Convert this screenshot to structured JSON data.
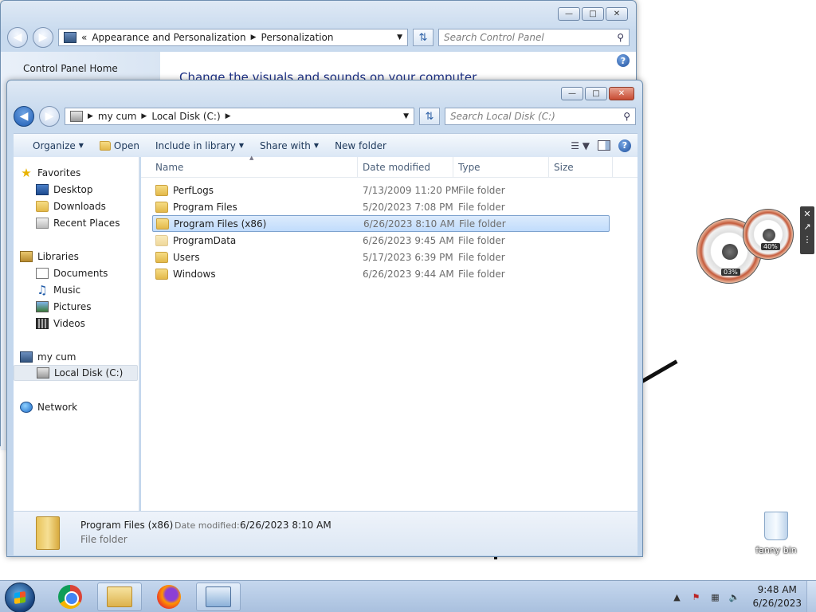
{
  "control_panel": {
    "breadcrumb": [
      "Appearance and Personalization",
      "Personalization"
    ],
    "search_placeholder": "Search Control Panel",
    "side_link": "Control Panel Home",
    "heading": "Change the visuals and sounds on your computer"
  },
  "explorer": {
    "breadcrumb": [
      "my cum",
      "Local Disk (C:)"
    ],
    "search_placeholder": "Search Local Disk (C:)",
    "toolbar": {
      "organize": "Organize",
      "open": "Open",
      "include_in_library": "Include in library",
      "share_with": "Share with",
      "new_folder": "New folder"
    },
    "nav": {
      "favorites": "Favorites",
      "favorites_items": [
        "Desktop",
        "Downloads",
        "Recent Places"
      ],
      "libraries": "Libraries",
      "libraries_items": [
        "Documents",
        "Music",
        "Pictures",
        "Videos"
      ],
      "computer": "my cum",
      "computer_items": [
        "Local Disk (C:)"
      ],
      "network": "Network"
    },
    "columns": [
      "Name",
      "Date modified",
      "Type",
      "Size"
    ],
    "files": [
      {
        "name": "PerfLogs",
        "date": "7/13/2009 11:20 PM",
        "type": "File folder"
      },
      {
        "name": "Program Files",
        "date": "5/20/2023 7:08 PM",
        "type": "File folder"
      },
      {
        "name": "Program Files (x86)",
        "date": "6/26/2023 8:10 AM",
        "type": "File folder"
      },
      {
        "name": "ProgramData",
        "date": "6/26/2023 9:45 AM",
        "type": "File folder"
      },
      {
        "name": "Users",
        "date": "5/17/2023 6:39 PM",
        "type": "File folder"
      },
      {
        "name": "Windows",
        "date": "6/26/2023 9:44 AM",
        "type": "File folder"
      }
    ],
    "selected_index": 2,
    "details": {
      "name": "Program Files (x86)",
      "modified_label": "Date modified:",
      "modified_value": "6/26/2023 8:10 AM",
      "type": "File folder"
    }
  },
  "gadget": {
    "cpu_pct": "03%",
    "mem_pct": "40%"
  },
  "desktop": {
    "recycle_bin": "fanny bin"
  },
  "taskbar": {
    "time": "9:48 AM",
    "date": "6/26/2023"
  },
  "colors": {
    "heading_blue": "#1e3287",
    "selection": "#c1dcfc",
    "taskbar": "#b9cde6"
  }
}
